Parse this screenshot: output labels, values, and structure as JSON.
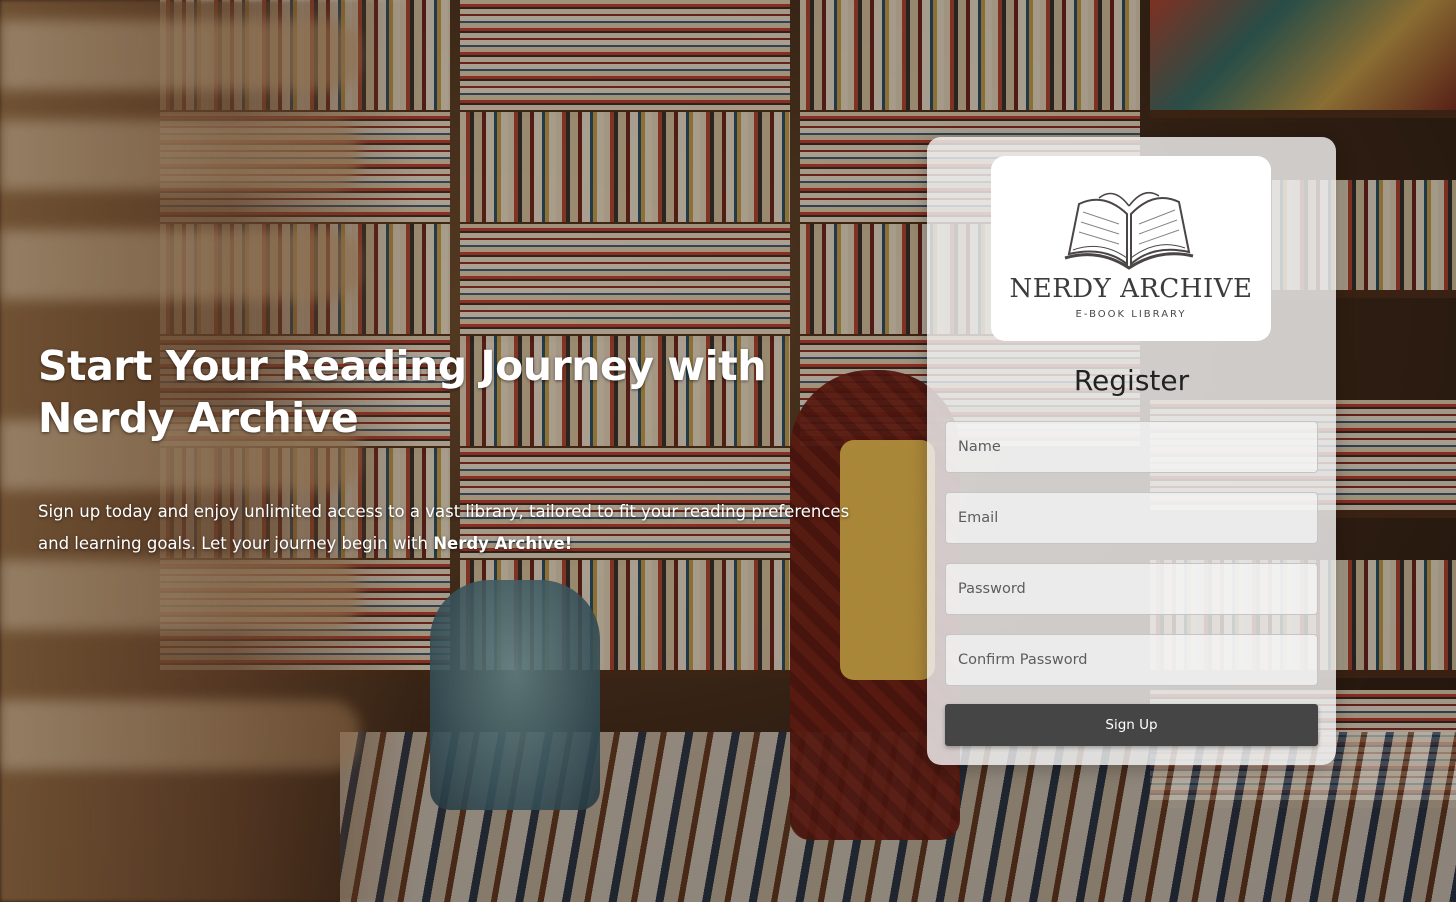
{
  "hero": {
    "title": "Start Your Reading Journey with Nerdy Archive",
    "description_prefix": "Sign up today and enjoy unlimited access to a vast library, tailored to fit your reading preferences and learning goals. Let your journey begin with ",
    "description_brand": "Nerdy Archive!"
  },
  "logo": {
    "name": "NERDY ARCHIVE",
    "tagline": "E-BOOK LIBRARY",
    "icon": "open-book-icon"
  },
  "register": {
    "title": "Register",
    "fields": {
      "name_placeholder": "Name",
      "email_placeholder": "Email",
      "password_placeholder": "Password",
      "confirm_placeholder": "Confirm Password"
    },
    "submit_label": "Sign Up"
  },
  "colors": {
    "button_bg": "#454545",
    "card_bg": "#f2f2f2",
    "text_light": "#ffffff"
  }
}
